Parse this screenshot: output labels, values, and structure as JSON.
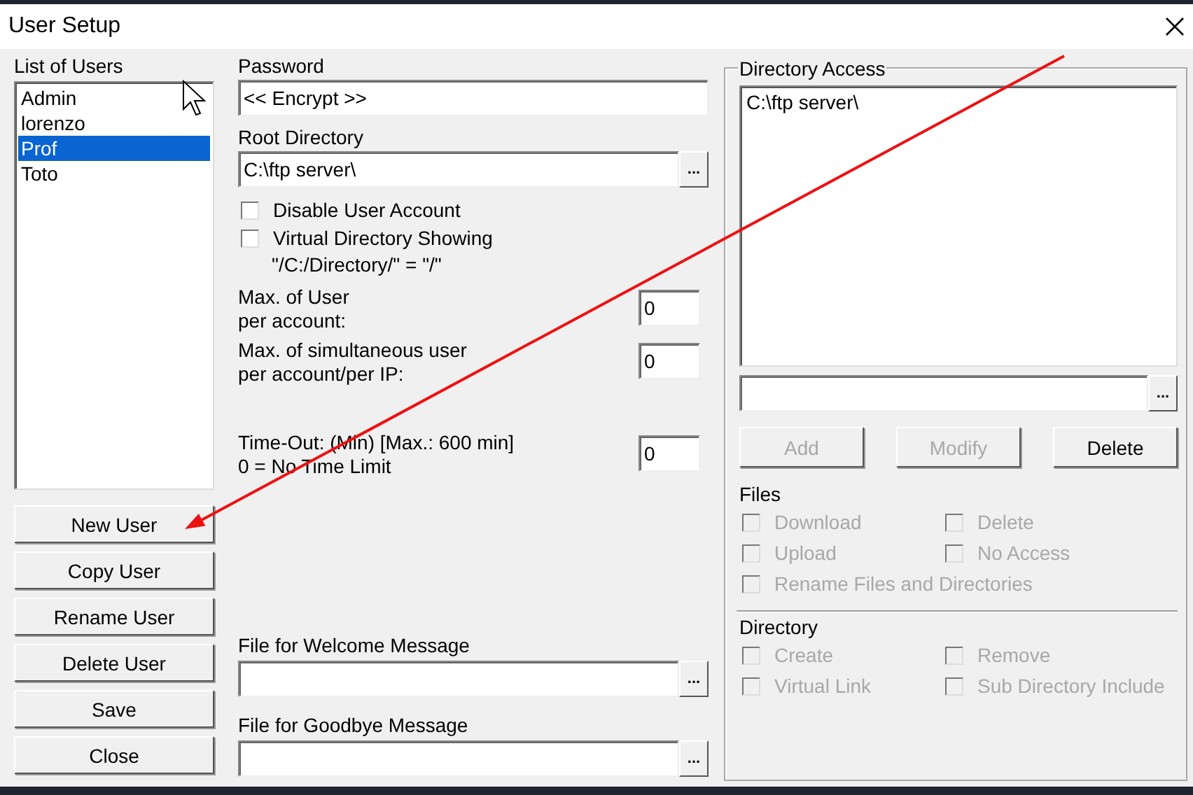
{
  "window": {
    "title": "User Setup"
  },
  "users": {
    "label": "List of Users",
    "items": [
      {
        "name": "Admin",
        "selected": false
      },
      {
        "name": "lorenzo",
        "selected": false
      },
      {
        "name": "Prof",
        "selected": true
      },
      {
        "name": "Toto",
        "selected": false
      }
    ]
  },
  "user_buttons": [
    "New User",
    "Copy User",
    "Rename User",
    "Delete User",
    "Save",
    "Close"
  ],
  "password": {
    "label": "Password",
    "value": "<< Encrypt >>"
  },
  "root_directory": {
    "label": "Root Directory",
    "value": "C:\\ftp server\\",
    "browse": "..."
  },
  "options": [
    {
      "label": "Disable User Account",
      "checked": false
    },
    {
      "label": "Virtual Directory Showing",
      "checked": false,
      "note": "\"/C:/Directory/\" = \"/\""
    }
  ],
  "limits": [
    {
      "label": "Max. of User\nper account:",
      "value": "0"
    },
    {
      "label": "Max. of simultaneous user\nper account/per IP:",
      "value": "0"
    },
    {
      "label": "Time-Out: (Min) [Max.: 600 min]\n0 = No Time Limit",
      "value": "0"
    }
  ],
  "welcome": {
    "label": "File for Welcome Message",
    "browse": "..."
  },
  "goodbye": {
    "label": "File for Goodbye Message",
    "browse": "..."
  },
  "directory_access": {
    "title": "Directory Access",
    "items": [
      {
        "path": "C:\\ftp server\\"
      }
    ],
    "browse": "...",
    "buttons": [
      {
        "label": "Add",
        "disabled": true
      },
      {
        "label": "Modify",
        "disabled": true
      },
      {
        "label": "Delete",
        "disabled": false
      }
    ]
  },
  "files": {
    "title": "Files",
    "options": [
      {
        "label": "Download",
        "checked": false,
        "disabled": true
      },
      {
        "label": "Delete",
        "checked": false,
        "disabled": true
      },
      {
        "label": "Upload",
        "checked": false,
        "disabled": true
      },
      {
        "label": "No Access",
        "checked": false,
        "disabled": true
      },
      {
        "label": "Rename Files and Directories",
        "checked": false,
        "disabled": true
      }
    ]
  },
  "directory": {
    "title": "Directory",
    "options": [
      {
        "label": "Create",
        "checked": false,
        "disabled": true
      },
      {
        "label": "Remove",
        "checked": false,
        "disabled": true
      },
      {
        "label": "Virtual Link",
        "checked": false,
        "disabled": true
      },
      {
        "label": "Sub Directory Include",
        "checked": false,
        "disabled": true
      }
    ]
  }
}
